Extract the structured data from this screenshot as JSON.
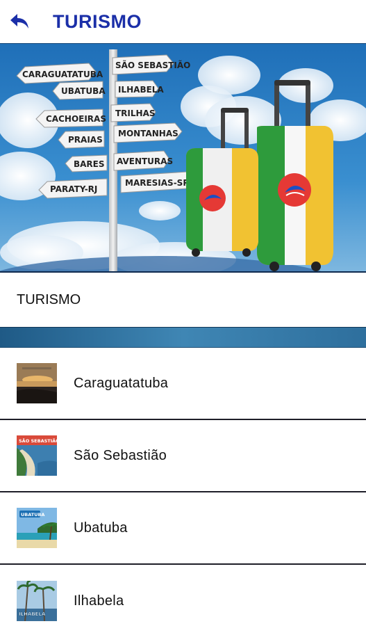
{
  "appbar": {
    "title": "TURISMO",
    "back_icon": "back-arrow-icon",
    "accent_color": "#1b2fa8"
  },
  "hero": {
    "signs": [
      "CARAGUATATUBA",
      "SÃO SEBASTIÃO",
      "UBATUBA",
      "ILHABELA",
      "CACHOEIRAS",
      "TRILHAS",
      "PRAIAS",
      "MONTANHAS",
      "BARES",
      "AVENTURAS",
      "PARATY-RJ",
      "MARESIAS-SP"
    ]
  },
  "section": {
    "title": "TURISMO"
  },
  "list": {
    "items": [
      {
        "label": "Caraguatatuba",
        "thumb_icon": "sunset-beach-thumbnail"
      },
      {
        "label": "São Sebastião",
        "thumb_icon": "coastline-thumbnail",
        "thumb_text": "SÃO SEBASTIÃO"
      },
      {
        "label": "Ubatuba",
        "thumb_icon": "beach-island-thumbnail",
        "thumb_text": "UBATUBA"
      },
      {
        "label": "Ilhabela",
        "thumb_icon": "palm-trees-thumbnail",
        "thumb_text": "ILHABELA"
      }
    ]
  }
}
